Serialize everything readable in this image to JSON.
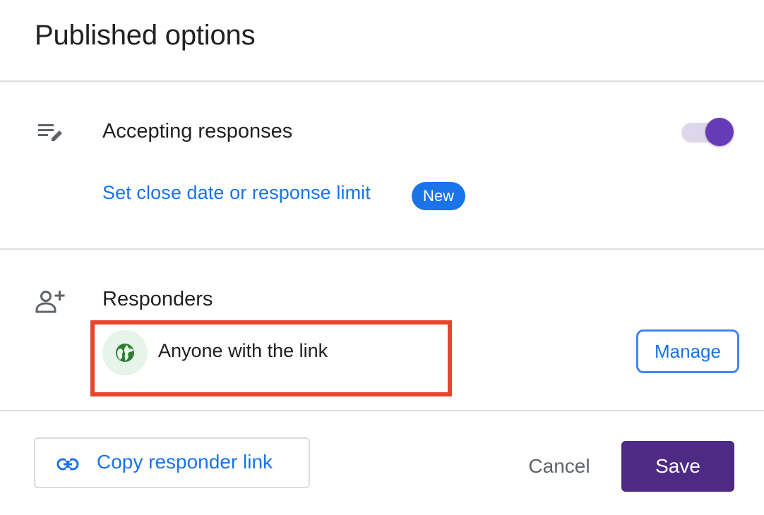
{
  "dialog": {
    "title": "Published options"
  },
  "accepting": {
    "icon": "edit-list-icon",
    "title": "Accepting responses",
    "toggle_on": true,
    "link": "Set close date or response limit",
    "badge": "New"
  },
  "responders": {
    "icon": "add-person-icon",
    "title": "Responders",
    "access_icon": "globe-icon",
    "access": "Anyone with the link",
    "manage_label": "Manage",
    "highlight_color": "#e8452c"
  },
  "footer": {
    "copy_icon": "link-icon",
    "copy_label": "Copy responder link",
    "cancel_label": "Cancel",
    "save_label": "Save"
  },
  "colors": {
    "accent_purple": "#673ab7",
    "save_purple": "#4e2a84",
    "link_blue": "#1a73e8",
    "globe_green": "#2e7d32"
  }
}
